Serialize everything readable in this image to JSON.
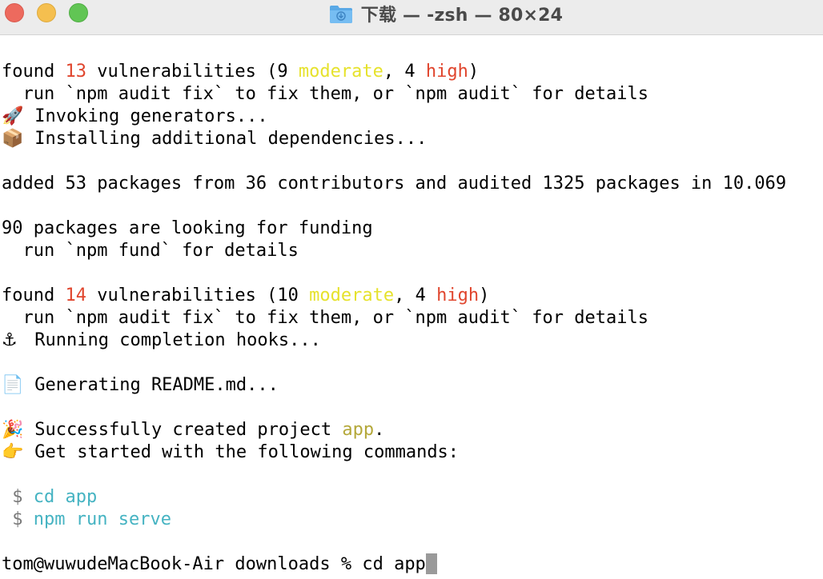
{
  "window": {
    "title": "下载 — -zsh — 80×24"
  },
  "lines": {
    "l1": {
      "a": "found ",
      "b": "13",
      "c": " vulnerabilities (9 ",
      "d": "moderate",
      "e": ", 4 ",
      "f": "high",
      "g": ")"
    },
    "l2": {
      "text": "  run `npm audit fix` to fix them, or `npm audit` for details"
    },
    "l3": {
      "emoji": "🚀",
      "text": " Invoking generators..."
    },
    "l4": {
      "emoji": "📦",
      "text": " Installing additional dependencies..."
    },
    "l6": {
      "text": "added 53 packages from 36 contributors and audited 1325 packages in 10.069"
    },
    "l8": {
      "text": "90 packages are looking for funding"
    },
    "l9": {
      "text": "  run `npm fund` for details"
    },
    "l11": {
      "a": "found ",
      "b": "14",
      "c": " vulnerabilities (10 ",
      "d": "moderate",
      "e": ", 4 ",
      "f": "high",
      "g": ")"
    },
    "l12": {
      "text": "  run `npm audit fix` to fix them, or `npm audit` for details"
    },
    "l13": {
      "emoji": "⚓",
      "text": " Running completion hooks..."
    },
    "l15": {
      "emoji": "📄",
      "text": " Generating README.md..."
    },
    "l17": {
      "emoji": "🎉",
      "a": " Successfully created project ",
      "b": "app",
      "c": "."
    },
    "l18": {
      "emoji": "👉",
      "text": " Get started with the following commands:"
    },
    "l20": {
      "prompt": " $ ",
      "cmd": "cd app"
    },
    "l21": {
      "prompt": " $ ",
      "cmd": "npm run serve"
    },
    "l23": {
      "text": "tom@wuwudeMacBook-Air downloads % cd app"
    }
  },
  "colors": {
    "red": "#e0452d",
    "yellow": "#e6e22c",
    "olive": "#b4a83a",
    "cyan": "#45b3c2",
    "cursor": "#9a9a9a"
  },
  "icons": {
    "title_folder": "downloads-folder-icon",
    "close": "close-button",
    "minimize": "minimize-button",
    "zoom": "zoom-button"
  }
}
